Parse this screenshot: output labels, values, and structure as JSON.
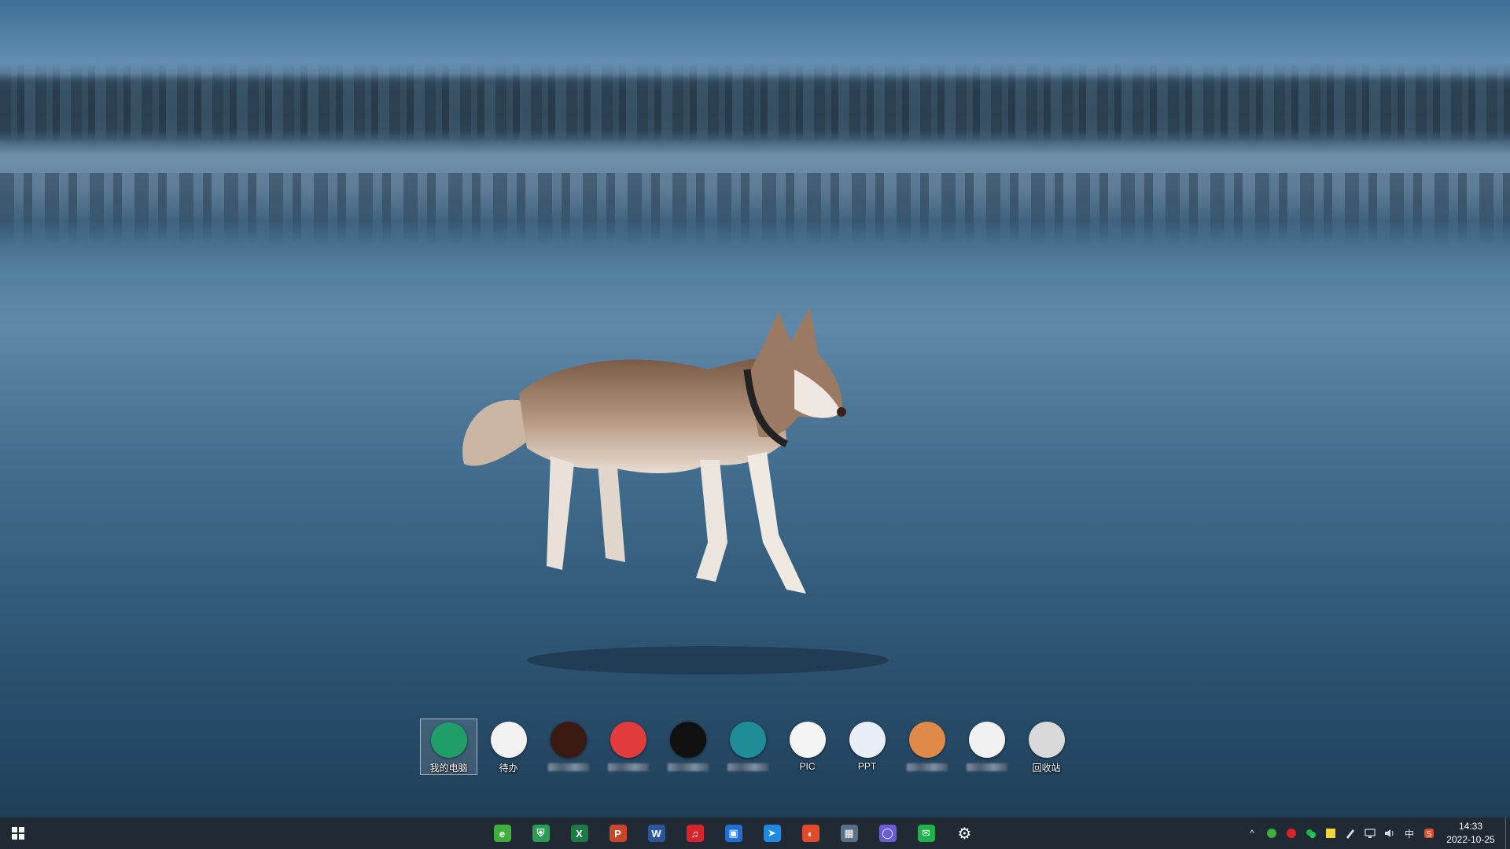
{
  "desktop": {
    "icons": [
      {
        "label": "我的电脑",
        "icon": "shield-pc-icon",
        "color": "#1f9e6a",
        "selected": true
      },
      {
        "label": "待办",
        "icon": "compass-todo-icon",
        "color": "#f2f2f2"
      },
      {
        "label": "",
        "icon": "red-fox-app-icon",
        "color": "#3a1a12"
      },
      {
        "label": "",
        "icon": "red-pinwheel-app-icon",
        "color": "#e23b3b"
      },
      {
        "label": "",
        "icon": "red-star-app-icon",
        "color": "#111111"
      },
      {
        "label": "",
        "icon": "teal-wave-app-icon",
        "color": "#1f8d97"
      },
      {
        "label": "PIC",
        "icon": "bull-head-icon",
        "color": "#f4f4f4"
      },
      {
        "label": "PPT",
        "icon": "k-logo-icon",
        "color": "#e9eef6"
      },
      {
        "label": "",
        "icon": "mountain-app-icon",
        "color": "#e08a4a"
      },
      {
        "label": "",
        "icon": "lion-app-icon",
        "color": "#f1f1f1"
      },
      {
        "label": "回收站",
        "icon": "recycle-bin-icon",
        "color": "#d9d9d9"
      }
    ]
  },
  "taskbar": {
    "pinned": [
      {
        "name": "green-browser-icon",
        "color": "#3fae3a",
        "glyph": "e"
      },
      {
        "name": "green-shield-icon",
        "color": "#2e9b55",
        "glyph": "⛨"
      },
      {
        "name": "excel-icon",
        "color": "#1d7a45",
        "glyph": "X"
      },
      {
        "name": "powerpoint-icon",
        "color": "#c9452b",
        "glyph": "P"
      },
      {
        "name": "word-icon",
        "color": "#2b579a",
        "glyph": "W"
      },
      {
        "name": "netease-music-icon",
        "color": "#d8232a",
        "glyph": "♫"
      },
      {
        "name": "blue-app-icon",
        "color": "#1f6fd6",
        "glyph": "▣"
      },
      {
        "name": "arrow-app-icon",
        "color": "#1e88e5",
        "glyph": "➤"
      },
      {
        "name": "red-swirl-app-icon",
        "color": "#e24a2a",
        "glyph": "◐"
      },
      {
        "name": "calculator-icon",
        "color": "#5b6f86",
        "glyph": "▦"
      },
      {
        "name": "purple-ring-icon",
        "color": "#6a5cd6",
        "glyph": "◯"
      },
      {
        "name": "wechat-icon",
        "color": "#20b14a",
        "glyph": "✉"
      },
      {
        "name": "settings-gear-icon",
        "color": "transparent",
        "glyph": "⚙"
      }
    ],
    "tray": {
      "overflow_glyph": "^",
      "ime_label": "中",
      "time": "14:33",
      "date": "2022-10-25"
    }
  }
}
